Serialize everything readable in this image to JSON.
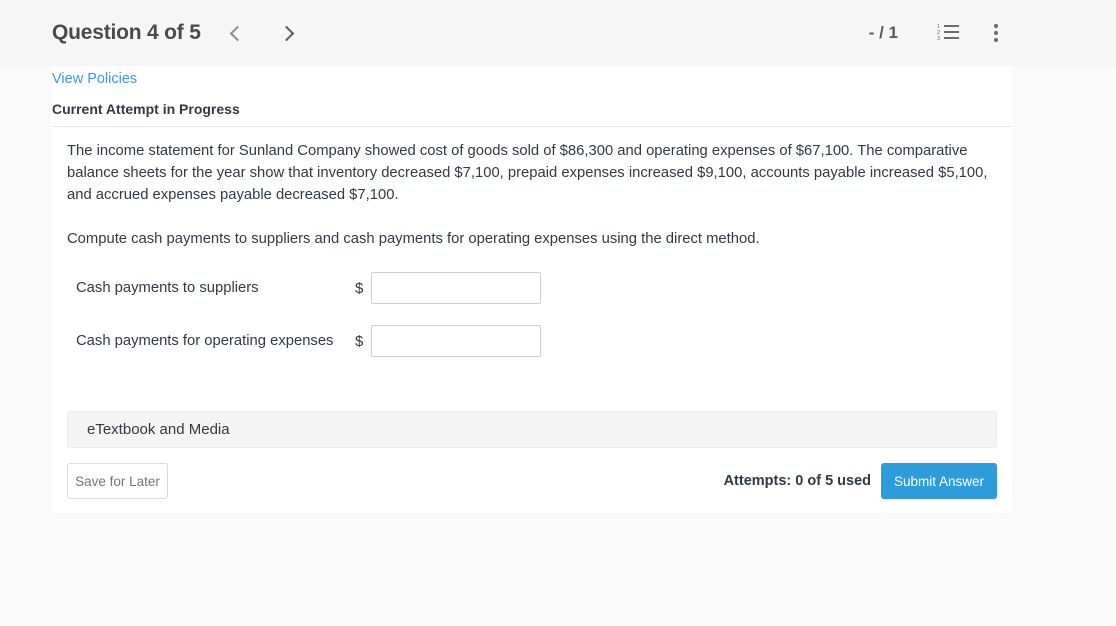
{
  "header": {
    "question_title": "Question 4 of 5",
    "prev_icon": "chevron-left-icon",
    "next_icon": "chevron-right-icon",
    "score": "- / 1",
    "list_icon": "numbered-list-icon",
    "list_numbers": [
      "1",
      "2",
      "3"
    ],
    "menu_icon": "kebab-menu-icon"
  },
  "panel": {
    "view_policies": "View Policies",
    "current_attempt": "Current Attempt in Progress"
  },
  "question": {
    "paragraph_1": "The income statement for Sunland Company showed cost of goods sold of $86,300 and operating expenses of $67,100. The comparative balance sheets for the year show that inventory decreased $7,100, prepaid expenses increased $9,100, accounts payable increased $5,100, and accrued expenses payable decreased $7,100.",
    "paragraph_2": "Compute cash payments to suppliers and cash payments for operating expenses using the direct method."
  },
  "answers": {
    "currency_symbol": "$",
    "rows": [
      {
        "label": "Cash payments to suppliers",
        "value": "",
        "placeholder": ""
      },
      {
        "label": "Cash payments for operating expenses",
        "value": "",
        "placeholder": ""
      }
    ]
  },
  "etextbook": {
    "label": "eTextbook and Media"
  },
  "footer": {
    "save_for_later": "Save for Later",
    "attempts": "Attempts: 0 of 5 used",
    "submit_answer": "Submit Answer"
  },
  "colors": {
    "accent_blue": "#2d9cdb",
    "link_blue": "#3c9ade",
    "page_bg": "#fafafa",
    "header_bg": "#f6f6f6",
    "panel_bg": "#ffffff",
    "text": "#2f3a45"
  }
}
